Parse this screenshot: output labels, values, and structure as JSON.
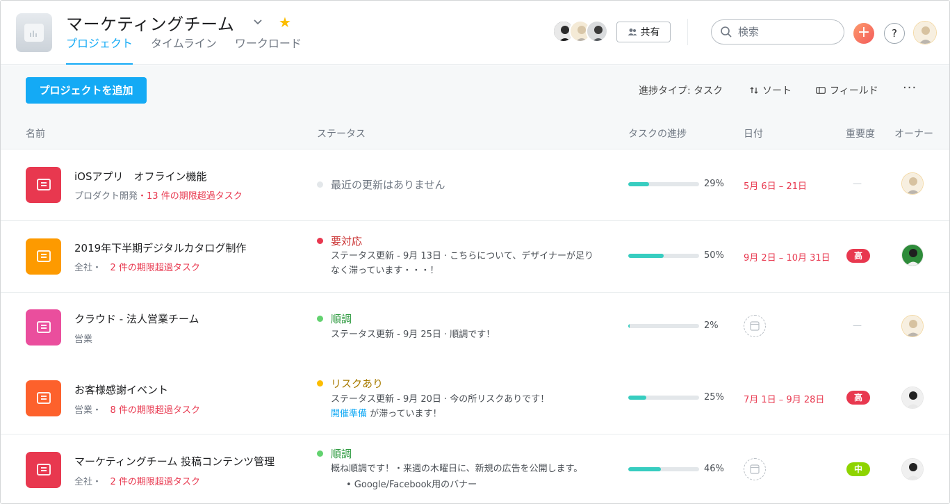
{
  "header": {
    "title": "マーケティングチーム",
    "tabs": [
      {
        "label": "プロジェクト",
        "active": true
      },
      {
        "label": "タイムライン",
        "active": false
      },
      {
        "label": "ワークロード",
        "active": false
      }
    ],
    "share_label": "共有",
    "search_placeholder": "検索",
    "plus_label": "+",
    "help_label": "?"
  },
  "toolbar": {
    "add_project_label": "プロジェクトを追加",
    "progress_type_label": "進捗タイプ: タスク",
    "sort_label": "ソート",
    "field_label": "フィールド",
    "more_label": "···"
  },
  "columns": {
    "name": "名前",
    "status": "ステータス",
    "progress": "タスクの進捗",
    "date": "日付",
    "priority": "重要度",
    "owner": "オーナー"
  },
  "colors": {
    "accent": "#14aaf5",
    "overdue": "#e8384f",
    "progress": "#37cdc0",
    "status_red": "#e8384f",
    "status_green": "#62d26f",
    "status_yellow": "#fcbd01",
    "status_none": "#e3e7ea",
    "priority_high": "#e8384f",
    "priority_mid": "#8ed400"
  },
  "projects": [
    {
      "name": "iOSアプリ　オフライン機能",
      "team": "プロダクト開発",
      "separator": "・",
      "overdue": "13 件の期限超過タスク",
      "icon_color": "#e8384f",
      "status_title": "最近の更新はありません",
      "status_color": "#e3e7ea",
      "progress": 29,
      "progress_text": "29%",
      "date": "5月 6日 – 21日",
      "priority": "—",
      "owner_icon": "owner-avatar-icon"
    },
    {
      "name": "2019年下半期デジタルカタログ制作",
      "team": "全社",
      "separator": "・",
      "overdue": "2 件の期限超過タスク",
      "icon_color": "#fd9a00",
      "status_title": "要対応",
      "status_color": "#e8384f",
      "status_desc_1": "ステータス更新 - 9月 13日 · こちらについて、デザイナーが足り",
      "status_desc_2": "なく滞っています・・・！",
      "progress": 50,
      "progress_text": "50%",
      "date": "9月 2日 – 10月 31日",
      "priority": "高",
      "owner_icon": "owner-avatar-icon"
    },
    {
      "name": "クラウド - 法人営業チーム",
      "team": "営業",
      "icon_color": "#ea4e9d",
      "status_title": "順調",
      "status_color": "#62d26f",
      "status_desc_1": "ステータス更新 - 9月 25日 · 順調です！",
      "progress": 2,
      "progress_text": "2%",
      "priority": "—",
      "owner_icon": "owner-avatar-icon"
    },
    {
      "name": "お客様感謝イベント",
      "team": "営業",
      "separator": "・",
      "overdue": "8 件の期限超過タスク",
      "icon_color": "#fd612c",
      "status_title": "リスクあり",
      "status_color": "#fcbd01",
      "status_desc_1": "ステータス更新 - 9月 20日 · 今の所リスクありです！",
      "status_link": "開催準備",
      "status_desc_2": " が滞っています！",
      "progress": 25,
      "progress_text": "25%",
      "date": "7月 1日 – 9月 28日",
      "priority": "高",
      "owner_icon": "owner-avatar-icon"
    },
    {
      "name": "マーケティングチーム 投稿コンテンツ管理",
      "team": "全社",
      "separator": "・",
      "overdue": "2 件の期限超過タスク",
      "icon_color": "#e8384f",
      "status_title": "順調",
      "status_color": "#62d26f",
      "status_desc_1": "概ね順調です！・来週の木曜日に、新規の広告を公開します。",
      "status_bullet": "•  Google/Facebook用のバナー",
      "progress": 46,
      "progress_text": "46%",
      "priority": "中",
      "owner_icon": "owner-avatar-icon"
    }
  ]
}
